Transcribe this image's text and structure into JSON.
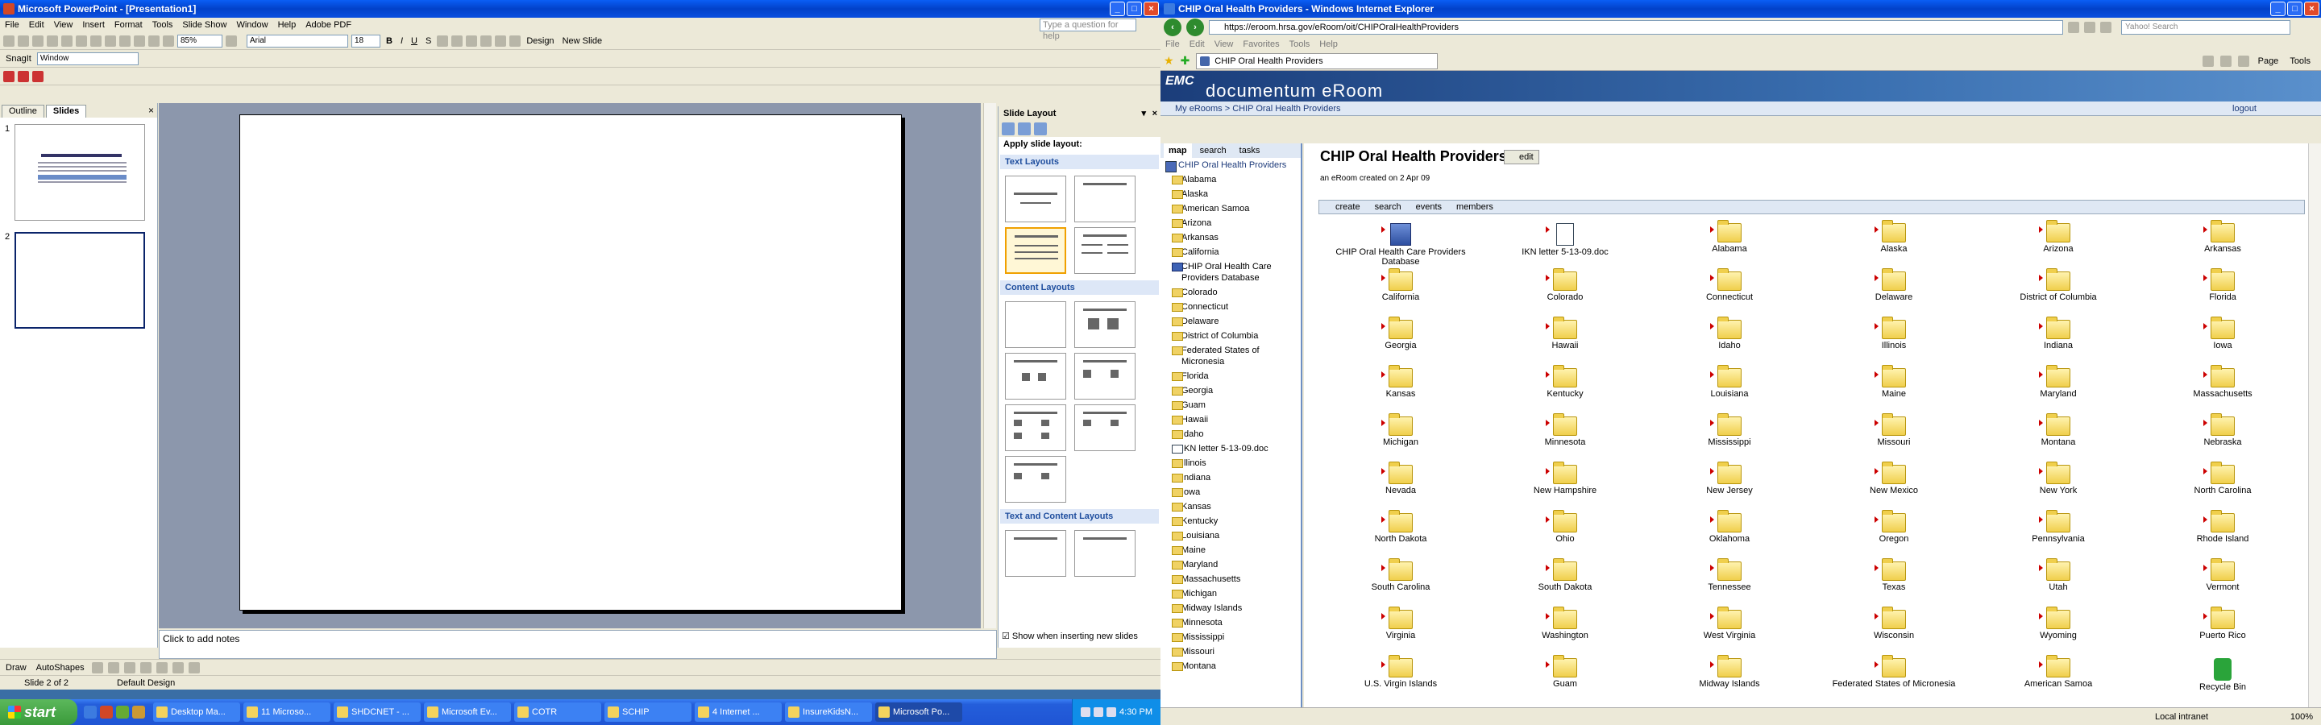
{
  "powerpoint": {
    "title": "Microsoft PowerPoint - [Presentation1]",
    "menu": [
      "File",
      "Edit",
      "View",
      "Insert",
      "Format",
      "Tools",
      "Slide Show",
      "Window",
      "Help",
      "Adobe PDF"
    ],
    "help_placeholder": "Type a question for help",
    "zoom": "85%",
    "font": "Arial",
    "font_size": "18",
    "design_label": "Design",
    "new_slide_label": "New Slide",
    "snagit_label": "SnagIt",
    "window_label": "Window",
    "tabs": [
      "Outline",
      "Slides"
    ],
    "slide_numbers": [
      "1",
      "2"
    ],
    "notes_placeholder": "Click to add notes",
    "status_slide": "Slide 2 of 2",
    "status_design": "Default Design",
    "draw_label": "Draw",
    "autoshapes_label": "AutoShapes",
    "taskpane": {
      "title": "Slide Layout",
      "apply_label": "Apply slide layout:",
      "sections": [
        "Text Layouts",
        "Content Layouts",
        "Text and Content Layouts"
      ],
      "show_label": "Show when inserting new slides"
    }
  },
  "taskbar": {
    "start": "start",
    "tasks": [
      "Desktop Ma...",
      "11 Microso...",
      "SHDCNET - ...",
      "Microsoft Ev...",
      "COTR",
      "SCHIP",
      "4 Internet ...",
      "InsureKidsN...",
      "Microsoft Po..."
    ],
    "clock": "4:30 PM"
  },
  "ie": {
    "title": "CHIP Oral Health Providers - Windows Internet Explorer",
    "url": "https://eroom.hrsa.gov/eRoom/oit/CHIPOralHealthProviders",
    "search_placeholder": "Yahoo! Search",
    "menu": [
      "File",
      "Edit",
      "View",
      "Favorites",
      "Tools",
      "Help"
    ],
    "tab_label": "CHIP Oral Health Providers",
    "cmd_page": "Page",
    "cmd_tools": "Tools",
    "status_zone": "Local intranet",
    "status_zoom": "100%"
  },
  "eroom": {
    "brand": "EMC",
    "product": "documentum eRoom",
    "breadcrumb": "My eRooms > CHIP Oral Health Providers",
    "logout": "logout",
    "nav_tabs": [
      "map",
      "search",
      "tasks"
    ],
    "tree": [
      "CHIP Oral Health Providers",
      "Alabama",
      "Alaska",
      "American Samoa",
      "Arizona",
      "Arkansas",
      "California",
      "CHIP Oral Health Care Providers Database",
      "Colorado",
      "Connecticut",
      "Delaware",
      "District of Columbia",
      "Federated States of Micronesia",
      "Florida",
      "Georgia",
      "Guam",
      "Hawaii",
      "Idaho",
      "IKN letter 5-13-09.doc",
      "Illinois",
      "Indiana",
      "Iowa",
      "Kansas",
      "Kentucky",
      "Louisiana",
      "Maine",
      "Maryland",
      "Massachusetts",
      "Michigan",
      "Midway Islands",
      "Minnesota",
      "Mississippi",
      "Missouri",
      "Montana"
    ],
    "title": "CHIP Oral Health Providers",
    "edit_label": "edit",
    "subtitle": "an eRoom created on 2 Apr 09",
    "actions": [
      "create",
      "search",
      "events",
      "members"
    ],
    "items": [
      {
        "label": "CHIP Oral Health Care Providers Database",
        "icon": "database-icon"
      },
      {
        "label": "IKN letter 5-13-09.doc",
        "icon": "document-icon"
      },
      {
        "label": "Alabama",
        "icon": "folder-icon"
      },
      {
        "label": "Alaska",
        "icon": "folder-icon"
      },
      {
        "label": "Arizona",
        "icon": "folder-icon"
      },
      {
        "label": "Arkansas",
        "icon": "folder-icon"
      },
      {
        "label": "California",
        "icon": "folder-icon"
      },
      {
        "label": "Colorado",
        "icon": "folder-icon"
      },
      {
        "label": "Connecticut",
        "icon": "folder-icon"
      },
      {
        "label": "Delaware",
        "icon": "folder-icon"
      },
      {
        "label": "District of Columbia",
        "icon": "folder-icon"
      },
      {
        "label": "Florida",
        "icon": "folder-icon"
      },
      {
        "label": "Georgia",
        "icon": "folder-icon"
      },
      {
        "label": "Hawaii",
        "icon": "folder-icon"
      },
      {
        "label": "Idaho",
        "icon": "folder-icon"
      },
      {
        "label": "Illinois",
        "icon": "folder-icon"
      },
      {
        "label": "Indiana",
        "icon": "folder-icon"
      },
      {
        "label": "Iowa",
        "icon": "folder-icon"
      },
      {
        "label": "Kansas",
        "icon": "folder-icon"
      },
      {
        "label": "Kentucky",
        "icon": "folder-icon"
      },
      {
        "label": "Louisiana",
        "icon": "folder-icon"
      },
      {
        "label": "Maine",
        "icon": "folder-icon"
      },
      {
        "label": "Maryland",
        "icon": "folder-icon"
      },
      {
        "label": "Massachusetts",
        "icon": "folder-icon"
      },
      {
        "label": "Michigan",
        "icon": "folder-icon"
      },
      {
        "label": "Minnesota",
        "icon": "folder-icon"
      },
      {
        "label": "Mississippi",
        "icon": "folder-icon"
      },
      {
        "label": "Missouri",
        "icon": "folder-icon"
      },
      {
        "label": "Montana",
        "icon": "folder-icon"
      },
      {
        "label": "Nebraska",
        "icon": "folder-icon"
      },
      {
        "label": "Nevada",
        "icon": "folder-icon"
      },
      {
        "label": "New Hampshire",
        "icon": "folder-icon"
      },
      {
        "label": "New Jersey",
        "icon": "folder-icon"
      },
      {
        "label": "New Mexico",
        "icon": "folder-icon"
      },
      {
        "label": "New York",
        "icon": "folder-icon"
      },
      {
        "label": "North Carolina",
        "icon": "folder-icon"
      },
      {
        "label": "North Dakota",
        "icon": "folder-icon"
      },
      {
        "label": "Ohio",
        "icon": "folder-icon"
      },
      {
        "label": "Oklahoma",
        "icon": "folder-icon"
      },
      {
        "label": "Oregon",
        "icon": "folder-icon"
      },
      {
        "label": "Pennsylvania",
        "icon": "folder-icon"
      },
      {
        "label": "Rhode Island",
        "icon": "folder-icon"
      },
      {
        "label": "South Carolina",
        "icon": "folder-icon"
      },
      {
        "label": "South Dakota",
        "icon": "folder-icon"
      },
      {
        "label": "Tennessee",
        "icon": "folder-icon"
      },
      {
        "label": "Texas",
        "icon": "folder-icon"
      },
      {
        "label": "Utah",
        "icon": "folder-icon"
      },
      {
        "label": "Vermont",
        "icon": "folder-icon"
      },
      {
        "label": "Virginia",
        "icon": "folder-icon"
      },
      {
        "label": "Washington",
        "icon": "folder-icon"
      },
      {
        "label": "West Virginia",
        "icon": "folder-icon"
      },
      {
        "label": "Wisconsin",
        "icon": "folder-icon"
      },
      {
        "label": "Wyoming",
        "icon": "folder-icon"
      },
      {
        "label": "Puerto Rico",
        "icon": "folder-icon"
      },
      {
        "label": "U.S. Virgin Islands",
        "icon": "folder-icon"
      },
      {
        "label": "Guam",
        "icon": "folder-icon"
      },
      {
        "label": "Midway Islands",
        "icon": "folder-icon"
      },
      {
        "label": "Federated States of Micronesia",
        "icon": "folder-icon"
      },
      {
        "label": "American Samoa",
        "icon": "folder-icon"
      },
      {
        "label": "Recycle Bin",
        "icon": "recycle-bin-icon"
      }
    ]
  },
  "colors": {
    "titlebar": "#0241c9",
    "eroom_banner": "#1b3d7a",
    "link": "#1c3a7a"
  }
}
